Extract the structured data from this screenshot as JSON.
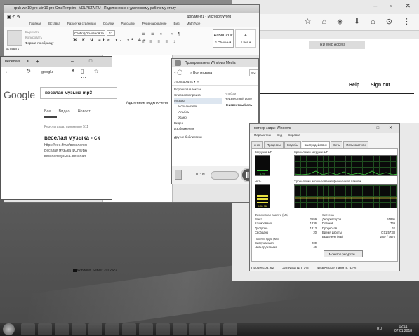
{
  "word": {
    "title": "rpuh-win10-pro-win10-pro-CmuTemplim - VDLPSTA.RU - Подключение к удаленному рабочему столу",
    "doc_title": "Документ1 - Microsoft Word",
    "tabs": [
      "Главная",
      "Вставка",
      "Разметка страницы",
      "Ссылки",
      "Рассылки",
      "Рецензирование",
      "Вид",
      "MathType"
    ],
    "paste_label": "Вставить",
    "cut_label": "Вырезать",
    "copy_label": "Копировать",
    "format_label": "Формат по образцу",
    "font_name": "Calibri (Основной те",
    "font_size": "11",
    "style_preview": "AaBbCcDc",
    "style_name": "1 Обычный",
    "style_name2": "1 Без и",
    "doc_text": "Удаленное подключени"
  },
  "browser": {
    "tab_label": "веселая",
    "url": "googl.r",
    "google_logo": "Google",
    "query": "веселая музыка mp3",
    "search_tabs": [
      "Все",
      "Видео",
      "Новост"
    ],
    "results_count": "Результатов: примерно 511",
    "result_title": "веселая музыка - ск",
    "result_url": "https://eee.ffm/s/веселая-м",
    "result_lines": [
      "Веселая музыка ФОНОВА",
      "веселая музыка. веселая"
    ]
  },
  "media_player": {
    "title": "Проигрыватель Windows Media",
    "breadcrumb": "» Вся музыка",
    "search_placeholder": "Вос",
    "menu_label": "Упорядочить",
    "tree": [
      "Воронцов Алексан",
      "Списки воспроизв",
      "Музыка",
      "Исполнитель",
      "Альбом",
      "Жанр",
      "Видео",
      "Изображения",
      "Другие библиотеки"
    ],
    "album_col": "Альбом",
    "album_items": [
      "Неизвестный испо",
      "Неизвестный аль"
    ],
    "time": "01:09"
  },
  "task_manager": {
    "title": "петчер задач Windows",
    "menu": [
      "Параметры",
      "Вид",
      "Справка"
    ],
    "tabs": [
      "ения",
      "Процессы",
      "Службы",
      "Быстродействие",
      "Сеть",
      "Пользователи"
    ],
    "active_tab": "Быстродействие",
    "cpu_label": "Загрузка ЦП",
    "cpu_history_label": "Хронология загрузки ЦП",
    "cpu_value": "1 %",
    "mem_label": "мять",
    "mem_history_label": "Хронология использования физической памяти",
    "mem_value": "1,31 ГБ",
    "phys_mem_title": "Физическая память (МБ)",
    "phys_mem": [
      [
        "Всего",
        "2559"
      ],
      [
        "Кэшировано",
        "1236"
      ],
      [
        "Доступно",
        "1213"
      ],
      [
        "Свободно",
        "20"
      ]
    ],
    "kernel_title": "Память ядра (МБ)",
    "kernel_mem": [
      [
        "Выгружаемая",
        "200"
      ],
      [
        "Невыгружаемая",
        "46"
      ]
    ],
    "system_title": "Система",
    "system": [
      [
        "Дескрипторов",
        "51895"
      ],
      [
        "Потоков",
        "769"
      ],
      [
        "Процессов",
        "62"
      ],
      [
        "Время работы",
        "0:01:57:38"
      ],
      [
        "Выделено (МБ)",
        "1867 / 7676"
      ]
    ],
    "resource_button": "Монитор ресурсов...",
    "status": [
      "Процессов: 62",
      "Загрузка ЦП: 1%",
      "Физическая память: 52%"
    ]
  },
  "remote_page": {
    "bar_label": "RD Web Access",
    "help": "Help",
    "signout": "Sign out"
  },
  "server_label": "Windows Server 2012 R2",
  "taskbar": {
    "language": "RU",
    "time": "12:11",
    "date": "07.01.2018"
  },
  "chrome": {
    "window_controls": "– ▫ ✕"
  }
}
